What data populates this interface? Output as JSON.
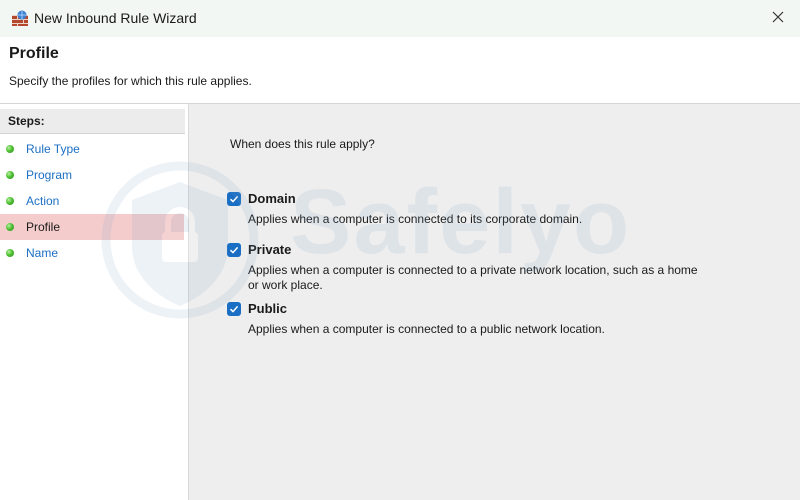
{
  "window": {
    "title": "New Inbound Rule Wizard"
  },
  "header": {
    "title": "Profile",
    "subtitle": "Specify the profiles for which this rule applies."
  },
  "sidebar": {
    "heading": "Steps:",
    "items": [
      {
        "label": "Rule Type",
        "active": false
      },
      {
        "label": "Program",
        "active": false
      },
      {
        "label": "Action",
        "active": false
      },
      {
        "label": "Profile",
        "active": true
      },
      {
        "label": "Name",
        "active": false
      }
    ]
  },
  "main": {
    "question": "When does this rule apply?",
    "options": [
      {
        "label": "Domain",
        "checked": true,
        "description": "Applies when a computer is connected to its corporate domain."
      },
      {
        "label": "Private",
        "checked": true,
        "description": "Applies when a computer is connected to a private network location, such as a home or work place."
      },
      {
        "label": "Public",
        "checked": true,
        "description": "Applies when a computer is connected to a public network location."
      }
    ]
  },
  "watermark": {
    "text": "Safelyo"
  },
  "colors": {
    "accent": "#1a6fc4",
    "active_step_bg": "#f4cccc",
    "link": "#1c6fc4",
    "status_dot": "#4fc034"
  },
  "icons": {
    "title": "firewall-icon",
    "close": "close-icon",
    "step": "green-dot-icon",
    "check": "checkmark-icon"
  }
}
